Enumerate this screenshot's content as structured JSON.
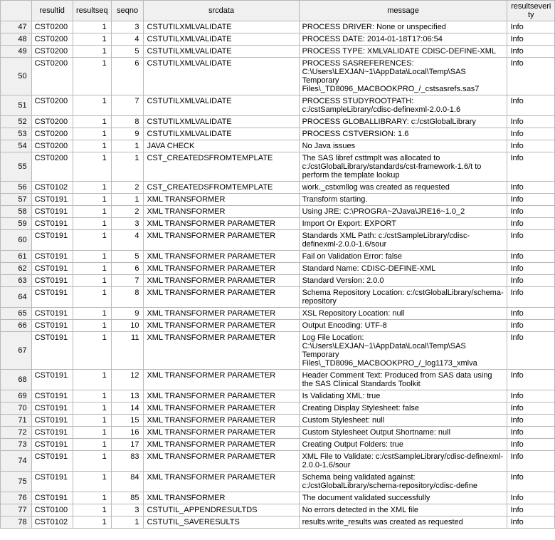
{
  "columns": {
    "rowhdr": "",
    "resultid": "resultid",
    "resultseq": "resultseq",
    "seqno": "seqno",
    "srcdata": "srcdata",
    "message": "message",
    "resultseverity": "resultseverity"
  },
  "rows": [
    {
      "n": "47",
      "resultid": "CST0200",
      "resultseq": "1",
      "seqno": "3",
      "srcdata": "CSTUTILXMLVALIDATE",
      "message": "PROCESS DRIVER: None or unspecified",
      "sev": "Info"
    },
    {
      "n": "48",
      "resultid": "CST0200",
      "resultseq": "1",
      "seqno": "4",
      "srcdata": "CSTUTILXMLVALIDATE",
      "message": "PROCESS DATE: 2014-01-18T17:06:54",
      "sev": "Info"
    },
    {
      "n": "49",
      "resultid": "CST0200",
      "resultseq": "1",
      "seqno": "5",
      "srcdata": "CSTUTILXMLVALIDATE",
      "message": "PROCESS TYPE: XMLVALIDATE CDISC-DEFINE-XML",
      "sev": "Info"
    },
    {
      "n": "50",
      "resultid": "CST0200",
      "resultseq": "1",
      "seqno": "6",
      "srcdata": "CSTUTILXMLVALIDATE",
      "message": "PROCESS SASREFERENCES: C:\\Users\\LEXJAN~1\\AppData\\Local\\Temp\\SAS Temporary Files\\_TD8096_MACBOOKPRO_/_cstsasrefs.sas7",
      "sev": "Info"
    },
    {
      "n": "51",
      "resultid": "CST0200",
      "resultseq": "1",
      "seqno": "7",
      "srcdata": "CSTUTILXMLVALIDATE",
      "message": "PROCESS STUDYROOTPATH: c:/cstSampleLibrary/cdisc-definexml-2.0.0-1.6",
      "sev": "Info"
    },
    {
      "n": "52",
      "resultid": "CST0200",
      "resultseq": "1",
      "seqno": "8",
      "srcdata": "CSTUTILXMLVALIDATE",
      "message": "PROCESS GLOBALLIBRARY: c:/cstGlobalLibrary",
      "sev": "Info"
    },
    {
      "n": "53",
      "resultid": "CST0200",
      "resultseq": "1",
      "seqno": "9",
      "srcdata": "CSTUTILXMLVALIDATE",
      "message": "PROCESS CSTVERSION: 1.6",
      "sev": "Info"
    },
    {
      "n": "54",
      "resultid": "CST0200",
      "resultseq": "1",
      "seqno": "1",
      "srcdata": "JAVA CHECK",
      "message": "No Java issues",
      "sev": "Info"
    },
    {
      "n": "55",
      "resultid": "CST0200",
      "resultseq": "1",
      "seqno": "1",
      "srcdata": "CST_CREATEDSFROMTEMPLATE",
      "message": "The SAS libref csttmplt was allocated to c:/cstGlobalLibrary/standards/cst-framework-1.6/t to perform the template lookup",
      "sev": "Info"
    },
    {
      "n": "56",
      "resultid": "CST0102",
      "resultseq": "1",
      "seqno": "2",
      "srcdata": "CST_CREATEDSFROMTEMPLATE",
      "message": "work._cstxmllog was created as requested",
      "sev": "Info"
    },
    {
      "n": "57",
      "resultid": "CST0191",
      "resultseq": "1",
      "seqno": "1",
      "srcdata": "XML TRANSFORMER",
      "message": "Transform starting.",
      "sev": "Info"
    },
    {
      "n": "58",
      "resultid": "CST0191",
      "resultseq": "1",
      "seqno": "2",
      "srcdata": "XML TRANSFORMER",
      "message": "Using JRE: C:\\PROGRA~2\\Java\\JRE16~1.0_2",
      "sev": "Info"
    },
    {
      "n": "59",
      "resultid": "CST0191",
      "resultseq": "1",
      "seqno": "3",
      "srcdata": "XML TRANSFORMER PARAMETER",
      "message": "Import Or Export: EXPORT",
      "sev": "Info"
    },
    {
      "n": "60",
      "resultid": "CST0191",
      "resultseq": "1",
      "seqno": "4",
      "srcdata": "XML TRANSFORMER PARAMETER",
      "message": "Standards XML Path: c:/cstSampleLibrary/cdisc-definexml-2.0.0-1.6/sour",
      "sev": "Info"
    },
    {
      "n": "61",
      "resultid": "CST0191",
      "resultseq": "1",
      "seqno": "5",
      "srcdata": "XML TRANSFORMER PARAMETER",
      "message": "Fail on Validation Error: false",
      "sev": "Info"
    },
    {
      "n": "62",
      "resultid": "CST0191",
      "resultseq": "1",
      "seqno": "6",
      "srcdata": "XML TRANSFORMER PARAMETER",
      "message": "Standard Name: CDISC-DEFINE-XML",
      "sev": "Info"
    },
    {
      "n": "63",
      "resultid": "CST0191",
      "resultseq": "1",
      "seqno": "7",
      "srcdata": "XML TRANSFORMER PARAMETER",
      "message": "Standard Version: 2.0.0",
      "sev": "Info"
    },
    {
      "n": "64",
      "resultid": "CST0191",
      "resultseq": "1",
      "seqno": "8",
      "srcdata": "XML TRANSFORMER PARAMETER",
      "message": "Schema Repository Location: c:/cstGlobalLibrary/schema-repository",
      "sev": "Info"
    },
    {
      "n": "65",
      "resultid": "CST0191",
      "resultseq": "1",
      "seqno": "9",
      "srcdata": "XML TRANSFORMER PARAMETER",
      "message": "XSL Repository Location: null",
      "sev": "Info"
    },
    {
      "n": "66",
      "resultid": "CST0191",
      "resultseq": "1",
      "seqno": "10",
      "srcdata": "XML TRANSFORMER PARAMETER",
      "message": "Output Encoding: UTF-8",
      "sev": "Info"
    },
    {
      "n": "67",
      "resultid": "CST0191",
      "resultseq": "1",
      "seqno": "11",
      "srcdata": "XML TRANSFORMER PARAMETER",
      "message": "Log File Location: C:\\Users\\LEXJAN~1\\AppData\\Local\\Temp\\SAS Temporary Files\\_TD8096_MACBOOKPRO_/_log1173_xmlva",
      "sev": "Info"
    },
    {
      "n": "68",
      "resultid": "CST0191",
      "resultseq": "1",
      "seqno": "12",
      "srcdata": "XML TRANSFORMER PARAMETER",
      "message": "Header Comment Text: Produced from SAS data using the SAS Clinical Standards Toolkit",
      "sev": "Info"
    },
    {
      "n": "69",
      "resultid": "CST0191",
      "resultseq": "1",
      "seqno": "13",
      "srcdata": "XML TRANSFORMER PARAMETER",
      "message": "Is Validating XML: true",
      "sev": "Info"
    },
    {
      "n": "70",
      "resultid": "CST0191",
      "resultseq": "1",
      "seqno": "14",
      "srcdata": "XML TRANSFORMER PARAMETER",
      "message": "Creating Display Stylesheet: false",
      "sev": "Info"
    },
    {
      "n": "71",
      "resultid": "CST0191",
      "resultseq": "1",
      "seqno": "15",
      "srcdata": "XML TRANSFORMER PARAMETER",
      "message": "Custom Stylesheet: null",
      "sev": "Info"
    },
    {
      "n": "72",
      "resultid": "CST0191",
      "resultseq": "1",
      "seqno": "16",
      "srcdata": "XML TRANSFORMER PARAMETER",
      "message": "Custom Stylesheet Output Shortname: null",
      "sev": "Info"
    },
    {
      "n": "73",
      "resultid": "CST0191",
      "resultseq": "1",
      "seqno": "17",
      "srcdata": "XML TRANSFORMER PARAMETER",
      "message": "Creating Output Folders: true",
      "sev": "Info"
    },
    {
      "n": "74",
      "resultid": "CST0191",
      "resultseq": "1",
      "seqno": "83",
      "srcdata": "XML TRANSFORMER PARAMETER",
      "message": "XML File to Validate: c:/cstSampleLibrary/cdisc-definexml-2.0.0-1.6/sour",
      "sev": "Info"
    },
    {
      "n": "75",
      "resultid": "CST0191",
      "resultseq": "1",
      "seqno": "84",
      "srcdata": "XML TRANSFORMER PARAMETER",
      "message": "Schema being validated against: c:/cstGlobalLibrary/schema-repository/cdisc-define",
      "sev": "Info"
    },
    {
      "n": "76",
      "resultid": "CST0191",
      "resultseq": "1",
      "seqno": "85",
      "srcdata": "XML TRANSFORMER",
      "message": "The document validated successfully",
      "sev": "Info"
    },
    {
      "n": "77",
      "resultid": "CST0100",
      "resultseq": "1",
      "seqno": "3",
      "srcdata": "CSTUTIL_APPENDRESULTDS",
      "message": "No errors detected in the XML file",
      "sev": "Info"
    },
    {
      "n": "78",
      "resultid": "CST0102",
      "resultseq": "1",
      "seqno": "1",
      "srcdata": "CSTUTIL_SAVERESULTS",
      "message": "results.write_results was created as requested",
      "sev": "Info"
    }
  ]
}
